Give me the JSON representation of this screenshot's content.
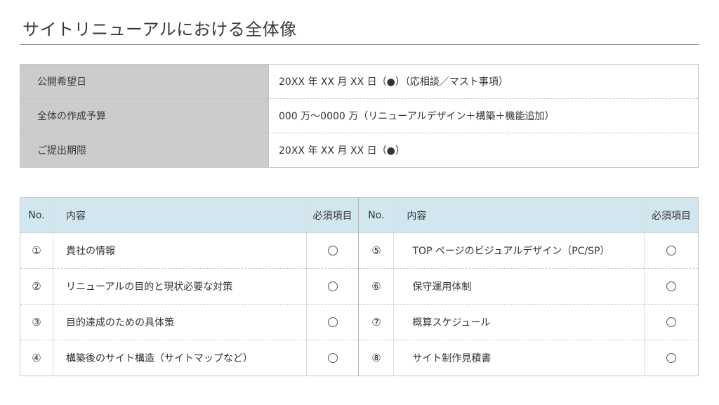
{
  "title": "サイトリニューアルにおける全体像",
  "summary": [
    {
      "label": "公開希望日",
      "value": "20XX 年 XX 月 XX 日（●）（応相談／マスト事項）"
    },
    {
      "label": "全体の作成予算",
      "value": "000 万〜0000 万（リニューアルデザイン＋構築＋機能追加）"
    },
    {
      "label": "ご提出期限",
      "value": "20XX 年 XX 月 XX 日（●）"
    }
  ],
  "checklist": {
    "headers": {
      "no": "No.",
      "content": "内容",
      "required": "必須項目"
    },
    "left": [
      {
        "no": "①",
        "content": "貴社の情報",
        "required": "circle"
      },
      {
        "no": "②",
        "content": "リニューアルの目的と現状必要な対策",
        "required": "circle"
      },
      {
        "no": "③",
        "content": "目的達成のための具体策",
        "required": "circle"
      },
      {
        "no": "④",
        "content": "構築後のサイト構造（サイトマップなど）",
        "required": "circle"
      }
    ],
    "right": [
      {
        "no": "⑤",
        "content": "TOP ページのビジュアルデザイン（PC/SP）",
        "required": "circle"
      },
      {
        "no": "⑥",
        "content": "保守運用体制",
        "required": "circle"
      },
      {
        "no": "⑦",
        "content": "概算スケジュール",
        "required": "circle"
      },
      {
        "no": "⑧",
        "content": "サイト制作見積書",
        "required": "circle"
      }
    ]
  },
  "colors": {
    "summary_label_bg": "#cccccc",
    "checklist_header_bg": "#d2e6f0",
    "title_rule": "#8c8c8c"
  }
}
